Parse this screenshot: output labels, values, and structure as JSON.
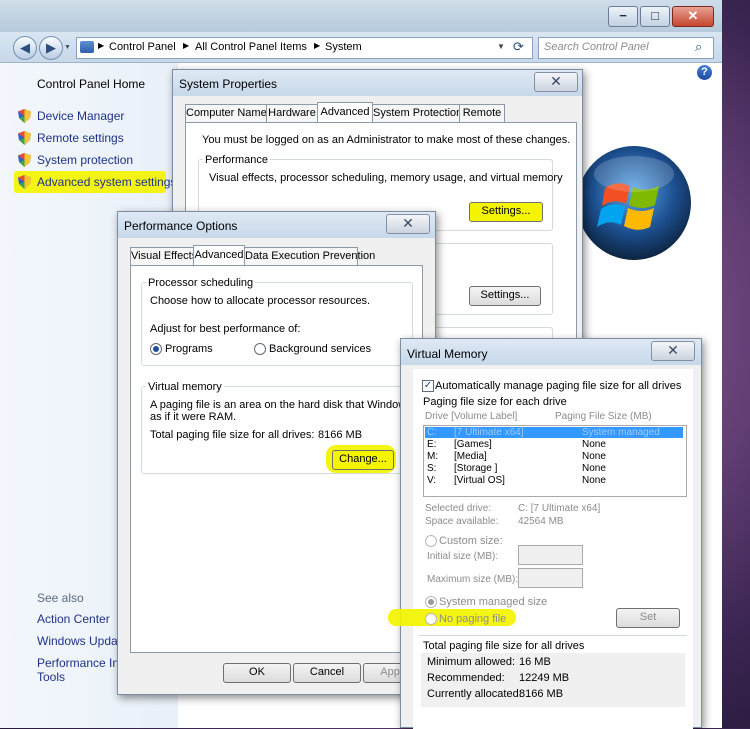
{
  "control_panel": {
    "breadcrumb": [
      "Control Panel",
      "All Control Panel Items",
      "System"
    ],
    "search_placeholder": "Search Control Panel",
    "minimize_glyph": "−",
    "maximize_glyph": "□",
    "close_glyph": "✕",
    "home_label": "Control Panel Home",
    "tasks": [
      {
        "label": "Device Manager"
      },
      {
        "label": "Remote settings"
      },
      {
        "label": "System protection"
      },
      {
        "label": "Advanced system settings"
      }
    ],
    "see_also_title": "See also",
    "see_also": [
      "Action Center",
      "Windows Update",
      "Performance Information and",
      "Tools"
    ],
    "help_glyph": "?"
  },
  "system_properties": {
    "title": "System Properties",
    "tabs": [
      "Computer Name",
      "Hardware",
      "Advanced",
      "System Protection",
      "Remote"
    ],
    "admin_note": "You must be logged on as an Administrator to make most of these changes.",
    "performance_label": "Performance",
    "performance_desc": "Visual effects, processor scheduling, memory usage, and virtual memory",
    "settings_button": "Settings...",
    "settings_button_2": "Settings...",
    "close_glyph": "✕"
  },
  "performance_options": {
    "title": "Performance Options",
    "tabs": [
      "Visual Effects",
      "Advanced",
      "Data Execution Prevention"
    ],
    "processor_scheduling_label": "Processor scheduling",
    "processor_desc": "Choose how to allocate processor resources.",
    "adjust_label": "Adjust for best performance of:",
    "radio_programs": "Programs",
    "radio_background": "Background services",
    "virtual_memory_label": "Virtual memory",
    "vm_desc_1": "A paging file is an area on the hard disk that Windows uses",
    "vm_desc_2": "as if it were RAM.",
    "total_label": "Total paging file size for all drives:",
    "total_value": "8166 MB",
    "change_button": "Change...",
    "ok_button": "OK",
    "cancel_button": "Cancel",
    "apply_button": "Apply",
    "close_glyph": "✕"
  },
  "virtual_memory": {
    "title": "Virtual Memory",
    "auto_manage_label": "Automatically manage paging file size for all drives",
    "auto_manage_checked": true,
    "check_glyph": "✓",
    "paging_each_drive": "Paging file size for each drive",
    "col_drive": "Drive  [Volume Label]",
    "col_size": "Paging File Size (MB)",
    "drives": [
      {
        "drive": "C:",
        "label": "[7 Ultimate x64]",
        "size": "System managed",
        "selected": true
      },
      {
        "drive": "E:",
        "label": "[Games]",
        "size": "None"
      },
      {
        "drive": "M:",
        "label": "[Media]",
        "size": "None"
      },
      {
        "drive": "S:",
        "label": "[Storage ]",
        "size": "None"
      },
      {
        "drive": "V:",
        "label": "[Virtual OS]",
        "size": "None"
      }
    ],
    "selected_drive_label": "Selected drive:",
    "selected_drive_value": "C:  [7 Ultimate x64]",
    "space_available_label": "Space available:",
    "space_available_value": "42564 MB",
    "custom_size_label": "Custom size:",
    "initial_size_label": "Initial size (MB):",
    "maximum_size_label": "Maximum size (MB):",
    "system_managed_label": "System managed size",
    "no_paging_label": "No paging file",
    "set_button": "Set",
    "total_title": "Total paging file size for all drives",
    "minimum_label": "Minimum allowed:",
    "minimum_value": "16 MB",
    "recommended_label": "Recommended:",
    "recommended_value": "12249 MB",
    "allocated_label": "Currently allocated:",
    "allocated_value": "8166 MB",
    "close_glyph": "✕"
  },
  "colors": {
    "highlight": "#f4f400",
    "link": "#1e3287",
    "selection": "#3399ff"
  }
}
